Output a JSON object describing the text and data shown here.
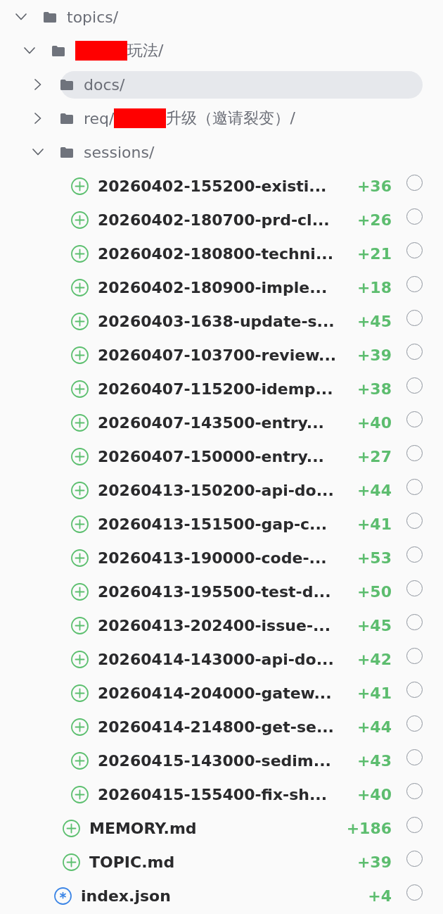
{
  "tree": [
    {
      "kind": "folder",
      "name_parts": [
        {
          "kind": "text",
          "text": "topics/"
        }
      ],
      "expanded": true,
      "selected": false,
      "children": [
        {
          "kind": "folder",
          "name_parts": [
            {
              "kind": "redaction"
            },
            {
              "kind": "text",
              "text": "玩法/"
            }
          ],
          "expanded": true,
          "selected": false,
          "children": [
            {
              "kind": "folder",
              "name_parts": [
                {
                  "kind": "text",
                  "text": "docs/"
                }
              ],
              "expanded": false,
              "selected": true
            },
            {
              "kind": "folder",
              "name_parts": [
                {
                  "kind": "text",
                  "text": "req/"
                },
                {
                  "kind": "redaction"
                },
                {
                  "kind": "text",
                  "text": "升级（邀请裂变）/"
                }
              ],
              "expanded": false,
              "selected": false
            },
            {
              "kind": "folder",
              "name_parts": [
                {
                  "kind": "text",
                  "text": "sessions/"
                }
              ],
              "expanded": true,
              "selected": false,
              "children": [
                {
                  "kind": "added",
                  "name": "20260402-155200-existi...",
                  "count": "+36",
                  "checked": false,
                  "selected": false
                },
                {
                  "kind": "added",
                  "name": "20260402-180700-prd-cl...",
                  "count": "+26",
                  "checked": false,
                  "selected": false
                },
                {
                  "kind": "added",
                  "name": "20260402-180800-techni...",
                  "count": "+21",
                  "checked": false,
                  "selected": false
                },
                {
                  "kind": "added",
                  "name": "20260402-180900-imple...",
                  "count": "+18",
                  "checked": false,
                  "selected": false
                },
                {
                  "kind": "added",
                  "name": "20260403-1638-update-s...",
                  "count": "+45",
                  "checked": false,
                  "selected": false
                },
                {
                  "kind": "added",
                  "name": "20260407-103700-review...",
                  "count": "+39",
                  "checked": false,
                  "selected": false
                },
                {
                  "kind": "added",
                  "name": "20260407-115200-idemp...",
                  "count": "+38",
                  "checked": false,
                  "selected": false
                },
                {
                  "kind": "added",
                  "name": "20260407-143500-entry...",
                  "count": "+40",
                  "checked": false,
                  "selected": false
                },
                {
                  "kind": "added",
                  "name": "20260407-150000-entry...",
                  "count": "+27",
                  "checked": false,
                  "selected": false
                },
                {
                  "kind": "added",
                  "name": "20260413-150200-api-do...",
                  "count": "+44",
                  "checked": false,
                  "selected": false
                },
                {
                  "kind": "added",
                  "name": "20260413-151500-gap-c...",
                  "count": "+41",
                  "checked": false,
                  "selected": false
                },
                {
                  "kind": "added",
                  "name": "20260413-190000-code-...",
                  "count": "+53",
                  "checked": false,
                  "selected": false
                },
                {
                  "kind": "added",
                  "name": "20260413-195500-test-d...",
                  "count": "+50",
                  "checked": false,
                  "selected": false
                },
                {
                  "kind": "added",
                  "name": "20260413-202400-issue-...",
                  "count": "+45",
                  "checked": false,
                  "selected": false
                },
                {
                  "kind": "added",
                  "name": "20260414-143000-api-do...",
                  "count": "+42",
                  "checked": false,
                  "selected": false
                },
                {
                  "kind": "added",
                  "name": "20260414-204000-gatew...",
                  "count": "+41",
                  "checked": false,
                  "selected": false
                },
                {
                  "kind": "added",
                  "name": "20260414-214800-get-se...",
                  "count": "+44",
                  "checked": false,
                  "selected": false
                },
                {
                  "kind": "added",
                  "name": "20260415-143000-sedim...",
                  "count": "+43",
                  "checked": false,
                  "selected": false
                },
                {
                  "kind": "added",
                  "name": "20260415-155400-fix-sh...",
                  "count": "+40",
                  "checked": false,
                  "selected": false
                }
              ]
            },
            {
              "kind": "added",
              "name": "MEMORY.md",
              "count": "+186",
              "checked": false,
              "selected": false
            },
            {
              "kind": "added",
              "name": "TOPIC.md",
              "count": "+39",
              "checked": false,
              "selected": false
            }
          ]
        },
        {
          "kind": "modified",
          "name": "index.json",
          "count": "+4",
          "checked": false,
          "selected": false
        }
      ]
    }
  ]
}
